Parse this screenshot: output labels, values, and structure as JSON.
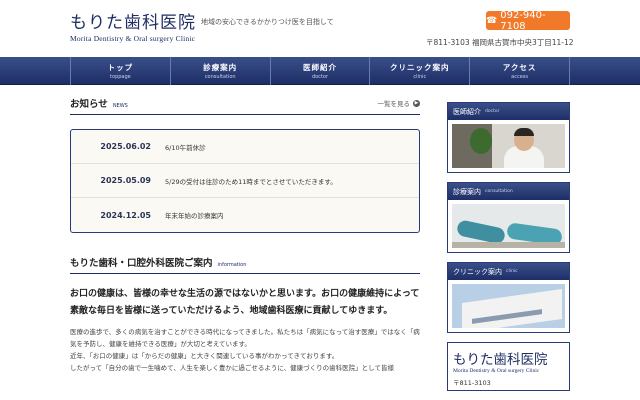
{
  "header": {
    "logo_jp": "もりた歯科医院",
    "logo_en": "Morita Dentistry & Oral surgery Clinic",
    "tagline": "地域の安心できるかかりつけ医を目指して",
    "phone": "092-940-7108",
    "phone_icon": "phone-icon",
    "address": "〒811-3103 福岡県古賀市中央3丁目11-12"
  },
  "nav": [
    {
      "jp": "トップ",
      "en": "toppage"
    },
    {
      "jp": "診療案内",
      "en": "consultation"
    },
    {
      "jp": "医師紹介",
      "en": "doctor"
    },
    {
      "jp": "クリニック案内",
      "en": "clinic"
    },
    {
      "jp": "アクセス",
      "en": "access"
    }
  ],
  "news": {
    "title": "お知らせ",
    "subtitle": "NEWS",
    "more": "一覧を見る",
    "items": [
      {
        "date": "2025.06.02",
        "text": "6/10午前休診"
      },
      {
        "date": "2025.05.09",
        "text": "5/29の受付は往診のため11時までとさせていただきます。"
      },
      {
        "date": "2024.12.05",
        "text": "年末年始の診療案内"
      }
    ]
  },
  "info": {
    "title": "もりた歯科・口腔外科医院ご案内",
    "subtitle": "information",
    "lead": "お口の健康は、皆様の幸せな生活の源ではないかと思います。お口の健康維持によって素敵な毎日を皆様に送っていただけるよう、地域歯科医療に貢献してゆきます。",
    "body": [
      "医療の進歩で、多くの病気を治すことができる時代になってきました。私たちは「病気になって治す医療」ではなく「病気を予防し、健康を維持できる医療」が大切と考えています。",
      "近年、「お口の健康」は「からだの健康」と大きく関連している事がわかってきております。",
      "したがって「自分の歯で一生噛めて、人生を楽しく豊かに過ごせるように、健康づくりの歯科医院」として皆様"
    ]
  },
  "sidebar": {
    "cards": [
      {
        "jp": "医師紹介",
        "en": "doctor"
      },
      {
        "jp": "診療案内",
        "en": "consultation"
      },
      {
        "jp": "クリニック案内",
        "en": "clinic"
      }
    ],
    "logo_jp": "もりた歯科医院",
    "logo_en": "Morita Dentistry & Oral surgery Clinic",
    "zip": "〒811-3103"
  },
  "colors": {
    "navy": "#1f2d63",
    "accent": "#f07a2a"
  }
}
